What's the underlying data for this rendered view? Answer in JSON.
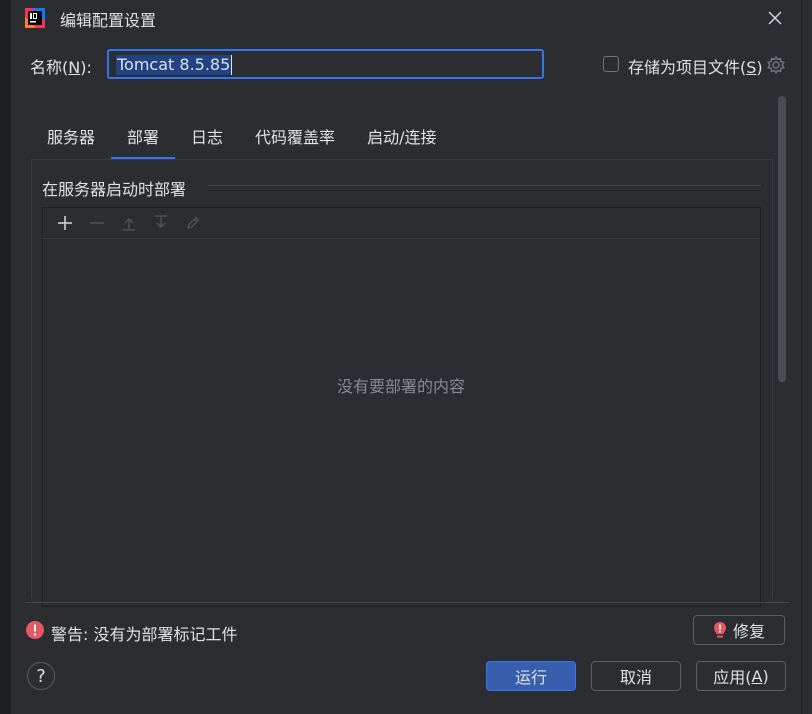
{
  "window": {
    "title": "编辑配置设置",
    "app_icon": "intellij-idea-icon",
    "close_icon": "close-icon"
  },
  "name_field": {
    "label_prefix": "名称(",
    "label_mnemonic": "N",
    "label_suffix": "):",
    "value": "Tomcat 8.5.85"
  },
  "store_option": {
    "label_prefix": "存储为项目文件(",
    "label_mnemonic": "S",
    "label_suffix": ")",
    "checked": false
  },
  "tabs": [
    {
      "label": "服务器",
      "active": false
    },
    {
      "label": "部署",
      "active": true
    },
    {
      "label": "日志",
      "active": false
    },
    {
      "label": "代码覆盖率",
      "active": false
    },
    {
      "label": "启动/连接",
      "active": false
    }
  ],
  "deploy": {
    "section_title": "在服务器启动时部署",
    "toolbar": [
      "add-icon",
      "remove-icon",
      "move-up-icon",
      "move-down-icon",
      "edit-icon"
    ],
    "empty_text": "没有要部署的内容"
  },
  "warning": {
    "text": "警告: 没有为部署标记工件",
    "fix_label": "修复"
  },
  "buttons": {
    "help": "?",
    "run": "运行",
    "cancel": "取消",
    "apply_prefix": "应用(",
    "apply_mnemonic": "A",
    "apply_suffix": ")"
  },
  "colors": {
    "accent": "#3574f0",
    "background": "#2b2d30",
    "warning": "#e55765",
    "run_button": "#375fad"
  }
}
